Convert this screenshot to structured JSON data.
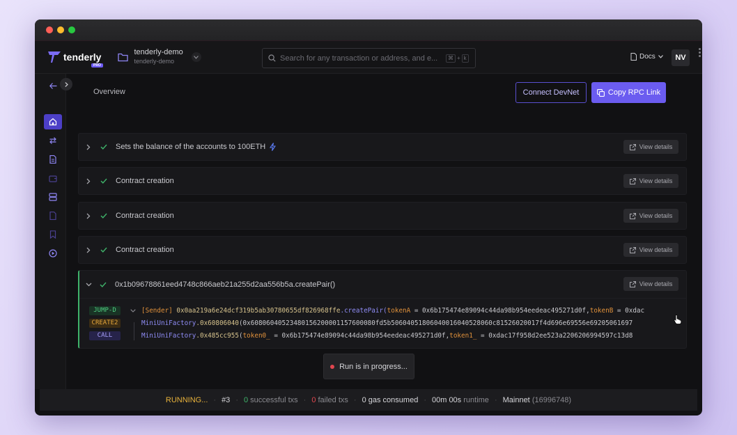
{
  "topbar": {
    "logo_text": "tenderly",
    "logo_badge": "PRO",
    "project_name": "tenderly-demo",
    "project_sub": "tenderly-demo",
    "search_placeholder": "Search for any transaction or address, and e...",
    "shortcut_key1": "⌘",
    "shortcut_plus": "+",
    "shortcut_key2": "k",
    "docs_label": "Docs",
    "avatar_initials": "NV"
  },
  "main": {
    "page_title": "Overview",
    "connect_button": "Connect DevNet",
    "copy_button": "Copy RPC Link"
  },
  "transactions": [
    {
      "title": "Sets the balance of the accounts to 100ETH",
      "view_label": "View details"
    },
    {
      "title": "Contract creation",
      "view_label": "View details"
    },
    {
      "title": "Contract creation",
      "view_label": "View details"
    },
    {
      "title": "Contract creation",
      "view_label": "View details"
    }
  ],
  "expanded_tx": {
    "title": "0x1b09678861eed4748c866aeb21a255d2aa556b5a.createPair()",
    "view_label": "View details",
    "trace": [
      {
        "op": "JUMP-D",
        "sender": "[Sender]",
        "address": "0x0aa219a6e24dcf319b5ab30780655df826968ffe",
        "fn": ".createPair(",
        "p1": "tokenA",
        "eq1": " = ",
        "v1": "0x6b175474e89094c44da98b954eedeac495271d0f, ",
        "p2": "tokenB",
        "eq2": " = ",
        "v2": "0xdac"
      },
      {
        "op": "CREATE2",
        "contract": "MiniUniFactory",
        "address": ".0x60806040",
        "args": "(0x60806040523480156200001157600080fd5b50604051806040016040528060c81526020017f4d696e69556e69205061697"
      },
      {
        "op": "CALL",
        "contract": "MiniUniFactory",
        "address": ".0x485cc955",
        "paren": "(",
        "p1": "token0_",
        "eq1": " = ",
        "v1": "0x6b175474e89094c44da98b954eedeac495271d0f, ",
        "p2": "token1_",
        "eq2": " = ",
        "v2": "0xdac17f958d2ee523a2206206994597c13d8"
      }
    ]
  },
  "toast": {
    "text": "Run is in progress..."
  },
  "status": {
    "running": "RUNNING...",
    "run_number": "#3",
    "successful_count": "0",
    "successful_label": "successful txs",
    "failed_count": "0",
    "failed_label": "failed txs",
    "gas": "0 gas consumed",
    "runtime_value": "00m 00s",
    "runtime_label": "runtime",
    "network": "Mainnet",
    "block": "(16996748)"
  },
  "colors": {
    "accent": "#6b5cf0",
    "success": "#3fb36a",
    "danger": "#e0464f",
    "running": "#e8b23b"
  }
}
